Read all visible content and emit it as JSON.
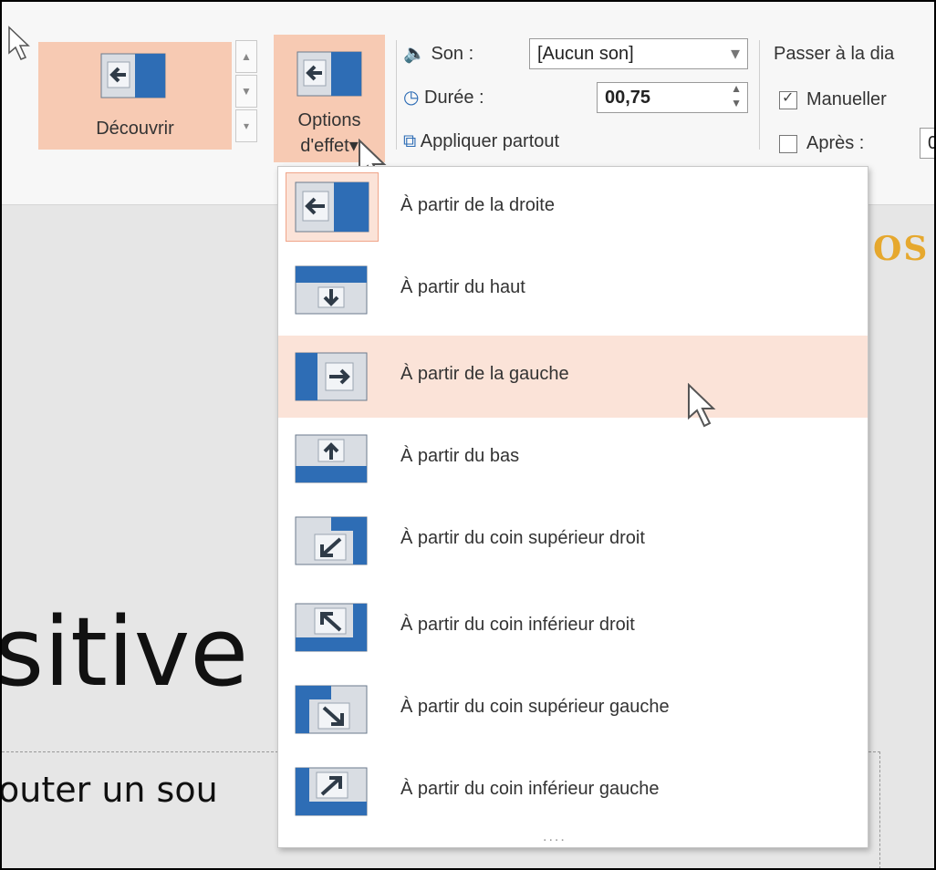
{
  "ribbon": {
    "gallery": {
      "selected_label": "Découvrir"
    },
    "options": {
      "label_line1": "Options",
      "label_line2": "d'effet"
    },
    "timing": {
      "sound_label": "Son :",
      "sound_value": "[Aucun son]",
      "duration_label": "Durée :",
      "duration_value": "00,75",
      "apply_all_label": "Appliquer partout"
    },
    "advance": {
      "title": "Passer à la dia",
      "manual_label": "Manueller",
      "after_label": "Après :",
      "after_value": "0"
    }
  },
  "menu": {
    "items": [
      {
        "label": "À partir de la droite",
        "icon": "wipe-from-right-icon",
        "selected": true
      },
      {
        "label": "À partir du haut",
        "icon": "wipe-from-top-icon"
      },
      {
        "label": "À partir de la gauche",
        "icon": "wipe-from-left-icon",
        "hovered": true
      },
      {
        "label": "À partir du bas",
        "icon": "wipe-from-bottom-icon"
      },
      {
        "label": "À partir du coin supérieur droit",
        "icon": "wipe-from-top-right-icon"
      },
      {
        "label": "À partir du coin inférieur droit",
        "icon": "wipe-from-bottom-right-icon"
      },
      {
        "label": "À partir du coin supérieur gauche",
        "icon": "wipe-from-top-left-icon"
      },
      {
        "label": "À partir du coin inférieur gauche",
        "icon": "wipe-from-bottom-left-icon"
      }
    ],
    "more_indicator": "....",
    "hover_color": "#fbe3d8",
    "accent_color": "#f7cab3"
  },
  "slide": {
    "title_fragment": "sitive",
    "subtitle_fragment": "outer un sou",
    "heading_fragment": "OS"
  }
}
